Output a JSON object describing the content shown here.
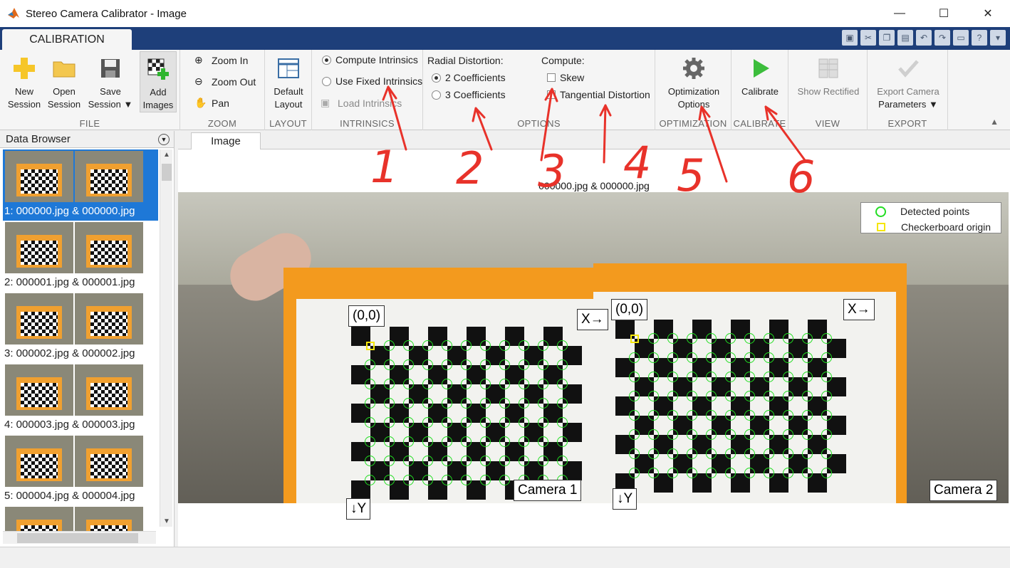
{
  "window": {
    "title": "Stereo Camera Calibrator - Image",
    "minimize": "—",
    "maximize": "☐",
    "close": "✕"
  },
  "ribbon": {
    "tab": "CALIBRATION",
    "file": {
      "label": "FILE",
      "new_session": [
        "New",
        "Session"
      ],
      "open_session": [
        "Open",
        "Session"
      ],
      "save_session": [
        "Save",
        "Session ▼"
      ],
      "add_images": [
        "Add",
        "Images"
      ]
    },
    "zoom": {
      "label": "ZOOM",
      "zoom_in": "Zoom In",
      "zoom_out": "Zoom Out",
      "pan": "Pan"
    },
    "layout": {
      "label": "LAYOUT",
      "default_layout": [
        "Default",
        "Layout"
      ]
    },
    "intrinsics": {
      "label": "INTRINSICS",
      "compute": "Compute Intrinsics",
      "use_fixed": "Use Fixed Intrinsics",
      "load": "Load Intrinsics",
      "selected": "compute"
    },
    "options": {
      "label": "OPTIONS",
      "radial_title": "Radial Distortion:",
      "two_coeff": "2 Coefficients",
      "three_coeff": "3 Coefficients",
      "radial_selected": "two",
      "compute_title": "Compute:",
      "skew": "Skew",
      "tangential": "Tangential Distortion",
      "skew_checked": false,
      "tangential_checked": false
    },
    "optimization": {
      "label": "OPTIMIZATION",
      "button": [
        "Optimization",
        "Options"
      ]
    },
    "calibrate": {
      "label": "CALIBRATE",
      "button": "Calibrate"
    },
    "view": {
      "label": "VIEW",
      "show_rectified": "Show Rectified"
    },
    "export": {
      "label": "EXPORT",
      "button": [
        "Export Camera",
        "Parameters ▼"
      ]
    }
  },
  "data_browser": {
    "title": "Data Browser",
    "items": [
      {
        "label": "1: 000000.jpg & 000000.jpg",
        "selected": true
      },
      {
        "label": "2: 000001.jpg & 000001.jpg",
        "selected": false
      },
      {
        "label": "3: 000002.jpg & 000002.jpg",
        "selected": false
      },
      {
        "label": "4: 000003.jpg & 000003.jpg",
        "selected": false
      },
      {
        "label": "5: 000004.jpg & 000004.jpg",
        "selected": false
      },
      {
        "label": "",
        "selected": false
      }
    ]
  },
  "document": {
    "tab": "Image",
    "image_title": "000000.jpg & 000000.jpg",
    "legend": {
      "detected": "Detected points",
      "origin": "Checkerboard origin"
    },
    "left": {
      "origin_label": "(0,0)",
      "x_label": "X→",
      "y_label": "↓Y",
      "camera": "Camera 1"
    },
    "right": {
      "origin_label": "(0,0)",
      "x_label": "X→",
      "y_label": "↓Y",
      "camera": "Camera 2"
    }
  },
  "annotations": {
    "numbers": [
      "1",
      "2",
      "3",
      "4",
      "5",
      "6"
    ],
    "color": "#e8322a"
  },
  "colors": {
    "title_bar_blue": "#1e3f7a",
    "selection": "#1e78d7",
    "detected_points": "#22dd22",
    "origin_marker": "#f5e60a",
    "board_orange": "#f39a1e"
  }
}
